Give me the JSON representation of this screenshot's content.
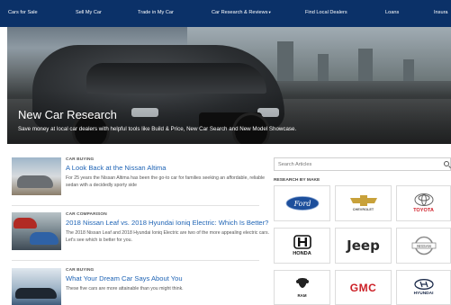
{
  "nav": {
    "items": [
      "Cars for Sale",
      "Sell My Car",
      "Trade in My Car",
      "Car Research & Reviews",
      "Find Local Dealers",
      "Loans",
      "Insura"
    ],
    "caret": "▾"
  },
  "hero": {
    "title": "New Car Research",
    "subtitle": "Save money at local car dealers with helpful tools like Build & Price, New Car Search and New Model Showcase."
  },
  "articles": [
    {
      "category": "CAR BUYING",
      "title": "A Look Back at the Nissan Altima",
      "description": "For 25 years the Nissan Altima has been the go-to car for families seeking an affordable, reliable sedan with a decidedly sporty side"
    },
    {
      "category": "CAR COMPARISON",
      "title": "2018 Nissan Leaf vs. 2018 Hyundai Ioniq Electric: Which Is Better?",
      "description": "The 2018 Nissan Leaf and 2018 Hyundai Ioniq Electric are two of the more appealing electric cars. Let's see which is better for you."
    },
    {
      "category": "CAR BUYING",
      "title": "What Your Dream Car Says About You",
      "description": "These five cars are more attainable than you might think."
    }
  ],
  "search": {
    "placeholder": "Search Articles"
  },
  "makes": {
    "heading": "RESEARCH BY MAKE",
    "brands": [
      {
        "name": "Ford",
        "color": "#1d4f9c"
      },
      {
        "name": "CHEVROLET",
        "color": "#c8a13a"
      },
      {
        "name": "TOYOTA",
        "color": "#d0202a"
      },
      {
        "name": "HONDA",
        "color": "#111111"
      },
      {
        "name": "Jeep",
        "color": "#2a2a2a"
      },
      {
        "name": "NISSAN",
        "color": "#7d7d7d"
      },
      {
        "name": "RAM",
        "color": "#222222"
      },
      {
        "name": "GMC",
        "color": "#cc2027"
      },
      {
        "name": "HYUNDAI",
        "color": "#1b2a4a"
      }
    ]
  },
  "colors": {
    "nav_bg": "#0b3168",
    "link": "#1f64b5"
  }
}
